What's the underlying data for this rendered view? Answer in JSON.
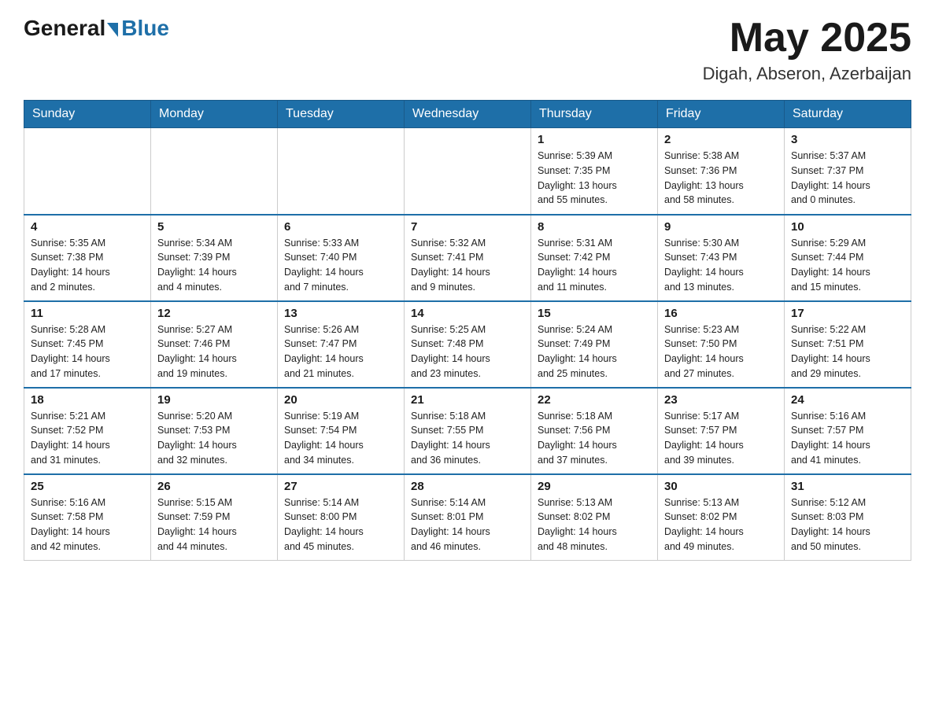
{
  "header": {
    "logo_general": "General",
    "logo_blue": "Blue",
    "month_title": "May 2025",
    "location": "Digah, Abseron, Azerbaijan"
  },
  "days_of_week": [
    "Sunday",
    "Monday",
    "Tuesday",
    "Wednesday",
    "Thursday",
    "Friday",
    "Saturday"
  ],
  "weeks": [
    [
      {
        "day": "",
        "info": ""
      },
      {
        "day": "",
        "info": ""
      },
      {
        "day": "",
        "info": ""
      },
      {
        "day": "",
        "info": ""
      },
      {
        "day": "1",
        "info": "Sunrise: 5:39 AM\nSunset: 7:35 PM\nDaylight: 13 hours\nand 55 minutes."
      },
      {
        "day": "2",
        "info": "Sunrise: 5:38 AM\nSunset: 7:36 PM\nDaylight: 13 hours\nand 58 minutes."
      },
      {
        "day": "3",
        "info": "Sunrise: 5:37 AM\nSunset: 7:37 PM\nDaylight: 14 hours\nand 0 minutes."
      }
    ],
    [
      {
        "day": "4",
        "info": "Sunrise: 5:35 AM\nSunset: 7:38 PM\nDaylight: 14 hours\nand 2 minutes."
      },
      {
        "day": "5",
        "info": "Sunrise: 5:34 AM\nSunset: 7:39 PM\nDaylight: 14 hours\nand 4 minutes."
      },
      {
        "day": "6",
        "info": "Sunrise: 5:33 AM\nSunset: 7:40 PM\nDaylight: 14 hours\nand 7 minutes."
      },
      {
        "day": "7",
        "info": "Sunrise: 5:32 AM\nSunset: 7:41 PM\nDaylight: 14 hours\nand 9 minutes."
      },
      {
        "day": "8",
        "info": "Sunrise: 5:31 AM\nSunset: 7:42 PM\nDaylight: 14 hours\nand 11 minutes."
      },
      {
        "day": "9",
        "info": "Sunrise: 5:30 AM\nSunset: 7:43 PM\nDaylight: 14 hours\nand 13 minutes."
      },
      {
        "day": "10",
        "info": "Sunrise: 5:29 AM\nSunset: 7:44 PM\nDaylight: 14 hours\nand 15 minutes."
      }
    ],
    [
      {
        "day": "11",
        "info": "Sunrise: 5:28 AM\nSunset: 7:45 PM\nDaylight: 14 hours\nand 17 minutes."
      },
      {
        "day": "12",
        "info": "Sunrise: 5:27 AM\nSunset: 7:46 PM\nDaylight: 14 hours\nand 19 minutes."
      },
      {
        "day": "13",
        "info": "Sunrise: 5:26 AM\nSunset: 7:47 PM\nDaylight: 14 hours\nand 21 minutes."
      },
      {
        "day": "14",
        "info": "Sunrise: 5:25 AM\nSunset: 7:48 PM\nDaylight: 14 hours\nand 23 minutes."
      },
      {
        "day": "15",
        "info": "Sunrise: 5:24 AM\nSunset: 7:49 PM\nDaylight: 14 hours\nand 25 minutes."
      },
      {
        "day": "16",
        "info": "Sunrise: 5:23 AM\nSunset: 7:50 PM\nDaylight: 14 hours\nand 27 minutes."
      },
      {
        "day": "17",
        "info": "Sunrise: 5:22 AM\nSunset: 7:51 PM\nDaylight: 14 hours\nand 29 minutes."
      }
    ],
    [
      {
        "day": "18",
        "info": "Sunrise: 5:21 AM\nSunset: 7:52 PM\nDaylight: 14 hours\nand 31 minutes."
      },
      {
        "day": "19",
        "info": "Sunrise: 5:20 AM\nSunset: 7:53 PM\nDaylight: 14 hours\nand 32 minutes."
      },
      {
        "day": "20",
        "info": "Sunrise: 5:19 AM\nSunset: 7:54 PM\nDaylight: 14 hours\nand 34 minutes."
      },
      {
        "day": "21",
        "info": "Sunrise: 5:18 AM\nSunset: 7:55 PM\nDaylight: 14 hours\nand 36 minutes."
      },
      {
        "day": "22",
        "info": "Sunrise: 5:18 AM\nSunset: 7:56 PM\nDaylight: 14 hours\nand 37 minutes."
      },
      {
        "day": "23",
        "info": "Sunrise: 5:17 AM\nSunset: 7:57 PM\nDaylight: 14 hours\nand 39 minutes."
      },
      {
        "day": "24",
        "info": "Sunrise: 5:16 AM\nSunset: 7:57 PM\nDaylight: 14 hours\nand 41 minutes."
      }
    ],
    [
      {
        "day": "25",
        "info": "Sunrise: 5:16 AM\nSunset: 7:58 PM\nDaylight: 14 hours\nand 42 minutes."
      },
      {
        "day": "26",
        "info": "Sunrise: 5:15 AM\nSunset: 7:59 PM\nDaylight: 14 hours\nand 44 minutes."
      },
      {
        "day": "27",
        "info": "Sunrise: 5:14 AM\nSunset: 8:00 PM\nDaylight: 14 hours\nand 45 minutes."
      },
      {
        "day": "28",
        "info": "Sunrise: 5:14 AM\nSunset: 8:01 PM\nDaylight: 14 hours\nand 46 minutes."
      },
      {
        "day": "29",
        "info": "Sunrise: 5:13 AM\nSunset: 8:02 PM\nDaylight: 14 hours\nand 48 minutes."
      },
      {
        "day": "30",
        "info": "Sunrise: 5:13 AM\nSunset: 8:02 PM\nDaylight: 14 hours\nand 49 minutes."
      },
      {
        "day": "31",
        "info": "Sunrise: 5:12 AM\nSunset: 8:03 PM\nDaylight: 14 hours\nand 50 minutes."
      }
    ]
  ]
}
